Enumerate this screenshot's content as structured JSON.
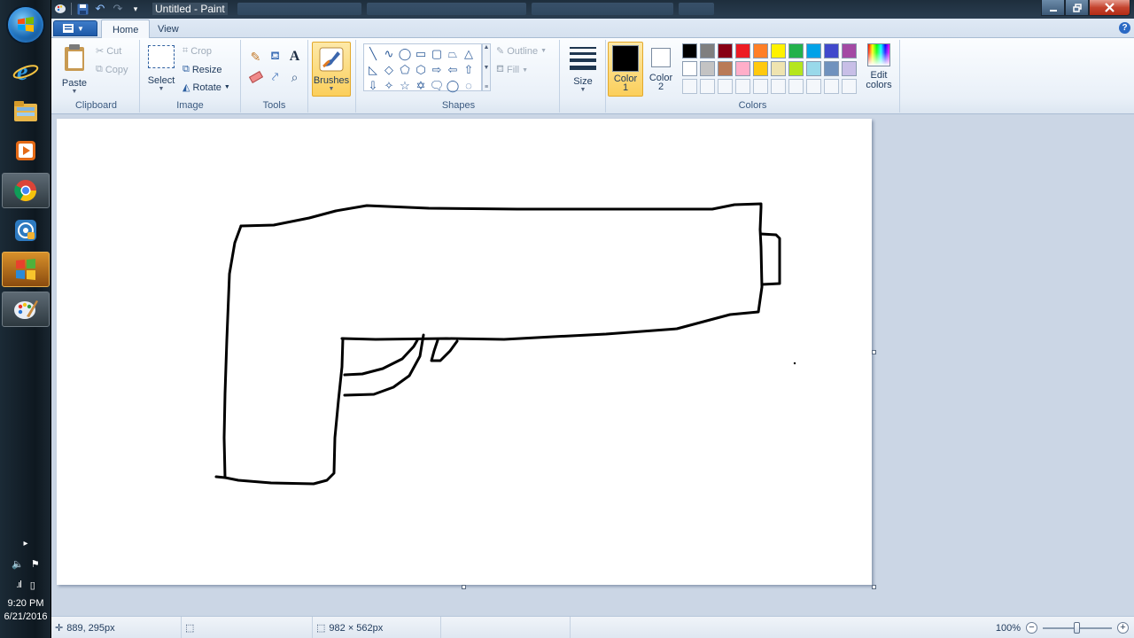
{
  "window": {
    "title": "Untitled - Paint",
    "qat_icons": [
      "paint-app-icon",
      "save-icon",
      "undo-icon",
      "redo-icon",
      "customize-qat-icon"
    ]
  },
  "ribbon_tabs": {
    "file_label": "",
    "home": "Home",
    "view": "View"
  },
  "clipboard": {
    "paste": "Paste",
    "cut": "Cut",
    "copy": "Copy",
    "label": "Clipboard"
  },
  "image": {
    "select": "Select",
    "crop": "Crop",
    "resize": "Resize",
    "rotate": "Rotate",
    "label": "Image"
  },
  "tools": {
    "label": "Tools",
    "text_tool": "A"
  },
  "brushes": {
    "label": "Brushes"
  },
  "shapes": {
    "outline": "Outline",
    "fill": "Fill",
    "label": "Shapes",
    "glyphs": [
      "╲",
      "∿",
      "◯",
      "▭",
      "▢",
      "⏢",
      "△",
      "◺",
      "◇",
      "⬠",
      "⬡",
      "⇨",
      "⇦",
      "⇧",
      "⇩",
      "✧",
      "☆",
      "✡",
      "🗨",
      "◯",
      "◌"
    ]
  },
  "size": {
    "label": "Size"
  },
  "colors": {
    "color1_label": "Color",
    "color1_num": "1",
    "color2_label": "Color",
    "color2_num": "2",
    "edit_label": "Edit",
    "edit_label2": "colors",
    "label": "Colors",
    "color1": "#000000",
    "color2": "#ffffff",
    "palette": [
      "#000000",
      "#7f7f7f",
      "#880015",
      "#ed1c24",
      "#ff7f27",
      "#fff200",
      "#22b14c",
      "#00a2e8",
      "#3f48cc",
      "#a349a4",
      "#ffffff",
      "#c3c3c3",
      "#b97a57",
      "#ffaec9",
      "#ffc90e",
      "#efe4b0",
      "#b5e61d",
      "#99d9ea",
      "#7092be",
      "#c8bfe7",
      "",
      "",
      "",
      "",
      "",
      "",
      "",
      "",
      "",
      ""
    ]
  },
  "statusbar": {
    "cursor": "889, 295px",
    "canvas_size": "982 × 562px",
    "zoom": "100%",
    "zoom_fraction": 0.5
  },
  "taskbar": {
    "time": "9:20 PM",
    "date": "6/21/2016"
  }
}
